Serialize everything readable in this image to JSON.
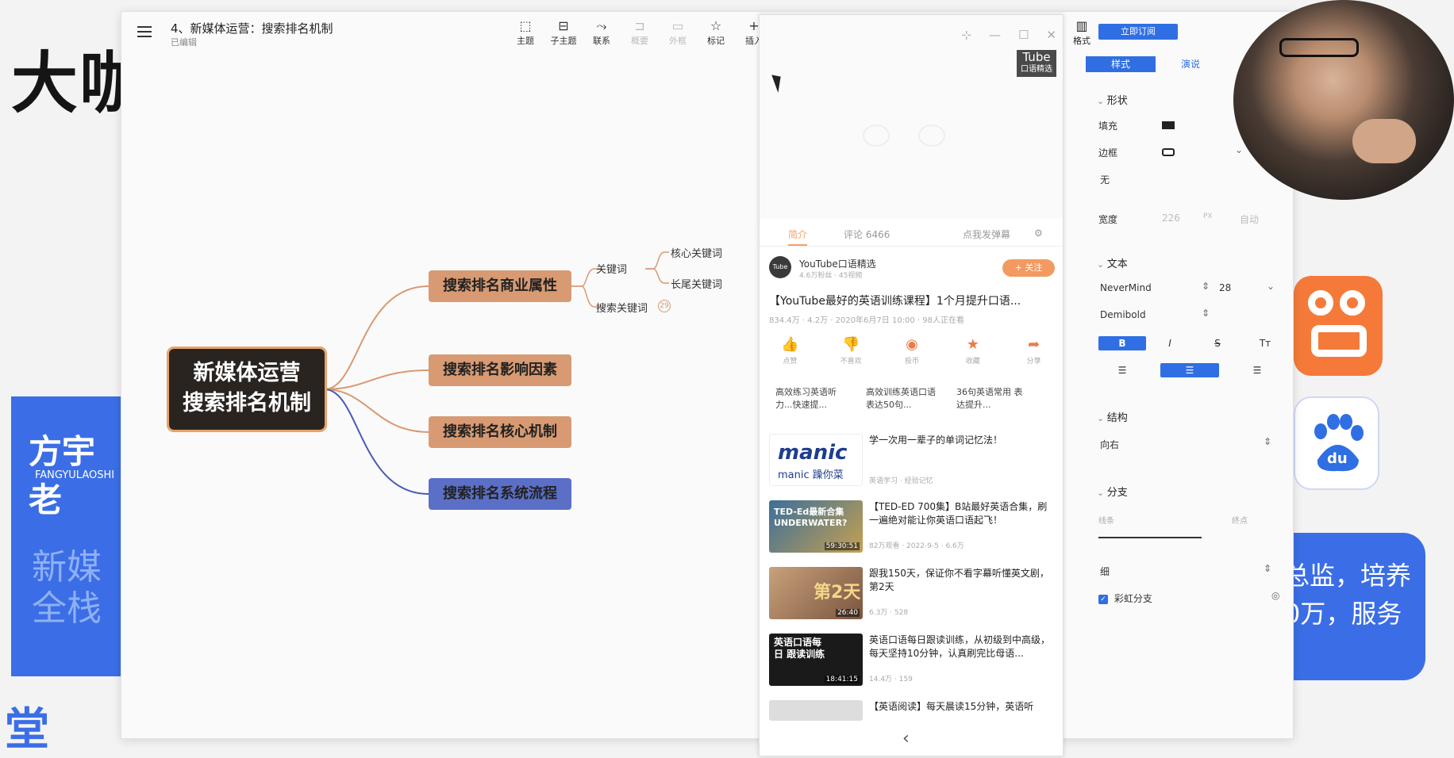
{
  "background": {
    "title": "大咖",
    "left_card_name": "方宇老",
    "left_card_pinyin": "FANGYULAOSHI",
    "left_card_faded": "新媒 全栈",
    "bottom_left_char": "堂",
    "right_card_text": "总监，培养 0万，服务"
  },
  "app": {
    "doc_title": "4、新媒体运营：搜索排名机制",
    "doc_status": "已编辑",
    "toolbar": [
      {
        "icon": "topic-icon",
        "glyph": "⬚",
        "label": "主题",
        "enabled": true
      },
      {
        "icon": "subtopic-icon",
        "glyph": "⊟",
        "label": "子主题",
        "enabled": true
      },
      {
        "icon": "relation-icon",
        "glyph": "⤳",
        "label": "联系",
        "enabled": true
      },
      {
        "icon": "summary-icon",
        "glyph": "⊐",
        "label": "概要",
        "enabled": false
      },
      {
        "icon": "boundary-icon",
        "glyph": "▭",
        "label": "外框",
        "enabled": false
      },
      {
        "icon": "star-icon",
        "glyph": "☆",
        "label": "标记",
        "enabled": true
      },
      {
        "icon": "plus-icon",
        "glyph": "+",
        "label": "插入",
        "enabled": true
      }
    ],
    "format_button": "格式"
  },
  "mindmap": {
    "root": "新媒体运营\n搜索排名机制",
    "topics": [
      {
        "label": "搜索排名商业属性",
        "color": "#d89a72"
      },
      {
        "label": "搜索排名影响因素",
        "color": "#d89a72"
      },
      {
        "label": "搜索排名核心机制",
        "color": "#d89a72"
      },
      {
        "label": "搜索排名系统流程",
        "color": "#5b6fc7"
      }
    ],
    "subtopics": {
      "keyword": "关键词",
      "core_keyword": "核心关键词",
      "long_tail_keyword": "长尾关键词",
      "search_keyword": "搜索关键词",
      "collapsed_count": "29"
    }
  },
  "phone": {
    "tube_logo": "Tube",
    "tube_logo_sub": "口语精选",
    "tabs": [
      "简介",
      "评论 6466",
      "点我发弹幕"
    ],
    "channel_name": "YouTube口语精选",
    "channel_meta": "4.6万粉丝 · 45视频",
    "follow_label": "+ 关注",
    "video_title": "【YouTube最好的英语训练课程】1个月提升口语...",
    "video_meta": "834.4万 · 4.2万 · 2020年6月7日 10:00 · 98人正在看",
    "actions": [
      "点赞",
      "不喜欢",
      "投币",
      "收藏",
      "分享"
    ],
    "related_text": [
      "高效练习英语听力...快速提...",
      "高效训练英语口语 表达50句...",
      "36句英语常用 表达提升..."
    ],
    "recommendations": [
      {
        "title": "学一次用一辈子的单词记忆法！",
        "meta": "英语学习 · 经验记忆",
        "thumb_text": "manic 躁你菜",
        "duration": ""
      },
      {
        "title": "【TED-ED 700集】B站最好英语合集，刷一遍绝对能让你英语口语起飞！",
        "meta": "82万观看 · 2022-9-5 · 6.6万",
        "thumb_text": "TED-Ed最新合集 UNDERWATER?",
        "duration": "59:30:51"
      },
      {
        "title": "跟我150天，保证你不看字幕听懂英文剧，第2天",
        "meta": "6.3万 · 528",
        "thumb_text": "第2天",
        "duration": "26:40"
      },
      {
        "title": "英语口语每日跟读训练，从初级到中高级，每天坚持10分钟，认真刷完比母语...",
        "meta": "14.4万 · 159",
        "thumb_text": "英语口语每日 跟读训练",
        "duration": "18:41:15"
      },
      {
        "title": "【英语阅读】每天晨读15分钟，英语听",
        "meta": "",
        "thumb_text": "",
        "duration": ""
      }
    ],
    "back_glyph": "‹"
  },
  "panel": {
    "subscribe_label": "立即订阅",
    "tabs": [
      "样式",
      "演说"
    ],
    "shape_section": "形状",
    "fill_label": "填充",
    "border_label": "边框",
    "border_none": "无",
    "width_label": "宽度",
    "width_value": "226",
    "width_unit": "PX",
    "width_auto": "自动",
    "text_section": "文本",
    "font_name": "NeverMind",
    "font_size": "28",
    "font_weight": "Demibold",
    "style_buttons": [
      "B",
      "I",
      "S",
      "Tт"
    ],
    "structure_section": "结构",
    "structure_value": "向右",
    "branch_section": "分支",
    "line_label": "线条",
    "end_label": "终点",
    "thickness_value": "细",
    "rainbow_label": "彩虹分支"
  }
}
